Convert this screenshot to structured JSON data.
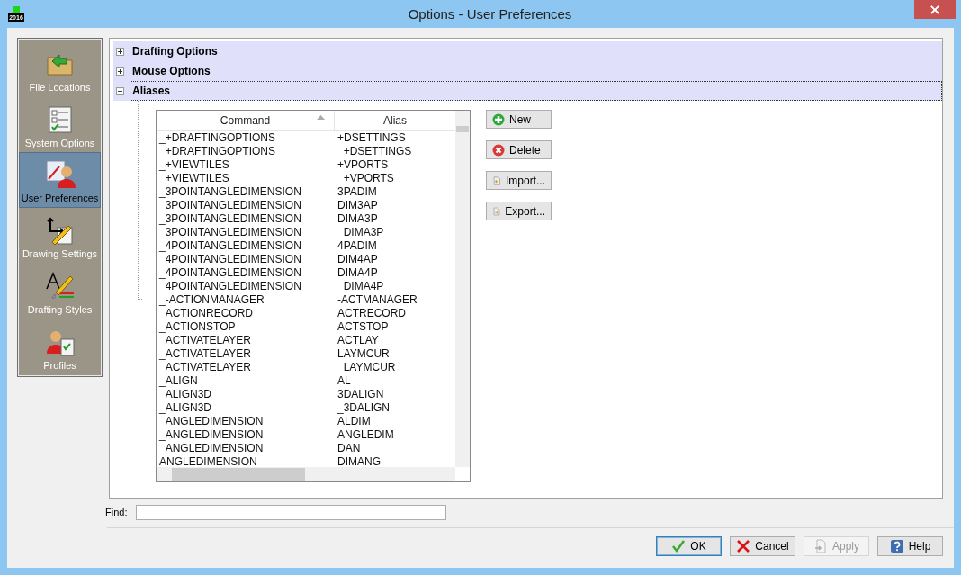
{
  "window": {
    "title": "Options - User Preferences",
    "app_badge": "2016",
    "close": "×"
  },
  "sidebar": {
    "items": [
      {
        "label": "File Locations",
        "selected": false
      },
      {
        "label": "System Options",
        "selected": false
      },
      {
        "label": "User Preferences",
        "selected": true
      },
      {
        "label": "Drawing Settings",
        "selected": false
      },
      {
        "label": "Drafting Styles",
        "selected": false
      },
      {
        "label": "Profiles",
        "selected": false
      }
    ]
  },
  "tree": [
    {
      "label": "Drafting Options",
      "expanded": false
    },
    {
      "label": "Mouse Options",
      "expanded": false
    },
    {
      "label": "Aliases",
      "expanded": true
    }
  ],
  "table": {
    "columns": [
      {
        "label": "Command",
        "sorted": true
      },
      {
        "label": "Alias",
        "sorted": false
      }
    ],
    "rows": [
      [
        "_+DRAFTINGOPTIONS",
        "+DSETTINGS"
      ],
      [
        "_+DRAFTINGOPTIONS",
        "_+DSETTINGS"
      ],
      [
        "_+VIEWTILES",
        "+VPORTS"
      ],
      [
        "_+VIEWTILES",
        "_+VPORTS"
      ],
      [
        "_3POINTANGLEDIMENSION",
        "3PADIM"
      ],
      [
        "_3POINTANGLEDIMENSION",
        "DIM3AP"
      ],
      [
        "_3POINTANGLEDIMENSION",
        "DIMA3P"
      ],
      [
        "_3POINTANGLEDIMENSION",
        "_DIMA3P"
      ],
      [
        "_4POINTANGLEDIMENSION",
        "4PADIM"
      ],
      [
        "_4POINTANGLEDIMENSION",
        "DIM4AP"
      ],
      [
        "_4POINTANGLEDIMENSION",
        "DIMA4P"
      ],
      [
        "_4POINTANGLEDIMENSION",
        "_DIMA4P"
      ],
      [
        "_-ACTIONMANAGER",
        "-ACTMANAGER"
      ],
      [
        "_ACTIONRECORD",
        "ACTRECORD"
      ],
      [
        "_ACTIONSTOP",
        "ACTSTOP"
      ],
      [
        "_ACTIVATELAYER",
        "ACTLAY"
      ],
      [
        "_ACTIVATELAYER",
        "LAYMCUR"
      ],
      [
        "_ACTIVATELAYER",
        "_LAYMCUR"
      ],
      [
        "_ALIGN",
        "AL"
      ],
      [
        "_ALIGN3D",
        "3DALIGN"
      ],
      [
        "_ALIGN3D",
        "_3DALIGN"
      ],
      [
        "_ANGLEDIMENSION",
        "ALDIM"
      ],
      [
        "_ANGLEDIMENSION",
        "ANGLEDIM"
      ],
      [
        "_ANGLEDIMENSION",
        "DAN"
      ],
      [
        "ANGLEDIMENSION",
        "DIMANG"
      ]
    ]
  },
  "alias_buttons": [
    {
      "label": "New"
    },
    {
      "label": "Delete"
    },
    {
      "label": "Import..."
    },
    {
      "label": "Export..."
    }
  ],
  "find": {
    "label": "Find:"
  },
  "buttons": [
    {
      "label": "OK",
      "default": true,
      "disabled": false
    },
    {
      "label": "Cancel",
      "default": false,
      "disabled": false
    },
    {
      "label": "Apply",
      "default": false,
      "disabled": true
    },
    {
      "label": "Help",
      "default": false,
      "disabled": false
    }
  ]
}
